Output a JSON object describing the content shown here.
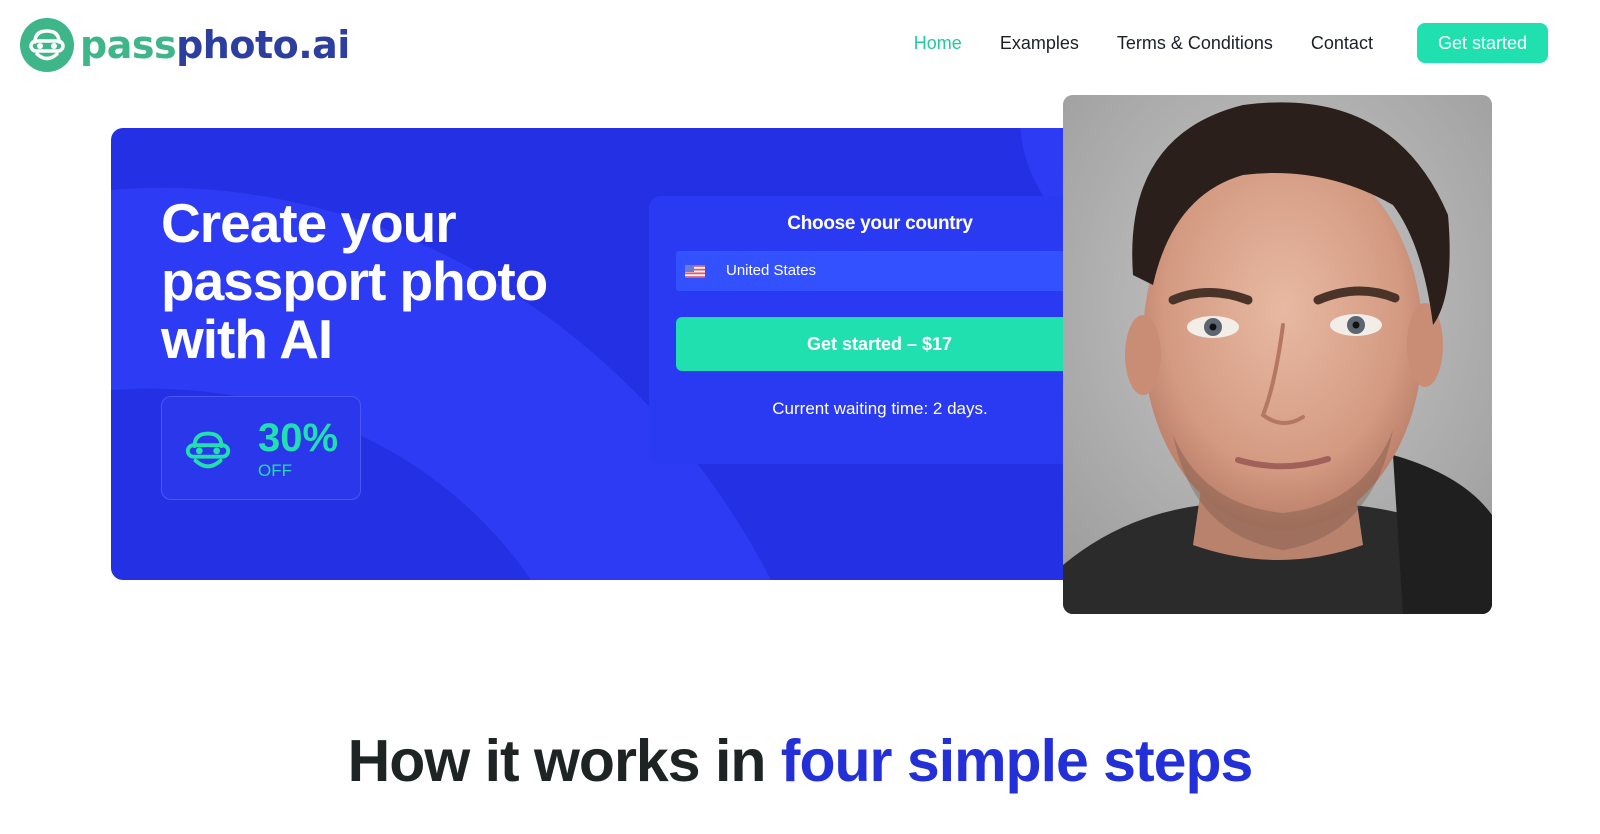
{
  "brand": {
    "name_part1": "pass",
    "name_part2": "photo.ai",
    "logo_icon": "robot-face-icon",
    "colors": {
      "green": "#3fb58a",
      "navy": "#2c3e9e"
    }
  },
  "nav": {
    "items": [
      {
        "label": "Home",
        "active": true
      },
      {
        "label": "Examples",
        "active": false
      },
      {
        "label": "Terms & Conditions",
        "active": false
      },
      {
        "label": "Contact",
        "active": false
      }
    ],
    "cta_label": "Get started"
  },
  "hero": {
    "title": "Create your passport photo with AI",
    "discount": {
      "percent": "30%",
      "label": "OFF",
      "icon": "robot-face-icon"
    },
    "country_card": {
      "title": "Choose your country",
      "selected_country": "United States",
      "flag_icon": "us-flag-icon",
      "cta_label": "Get started – $17",
      "waiting_text": "Current waiting time: 2 days."
    },
    "colors": {
      "background": "#2330e3",
      "accent": "#21e0b0"
    }
  },
  "how_it_works": {
    "title_dark": "How it works in",
    "title_accent": "four simple steps"
  }
}
